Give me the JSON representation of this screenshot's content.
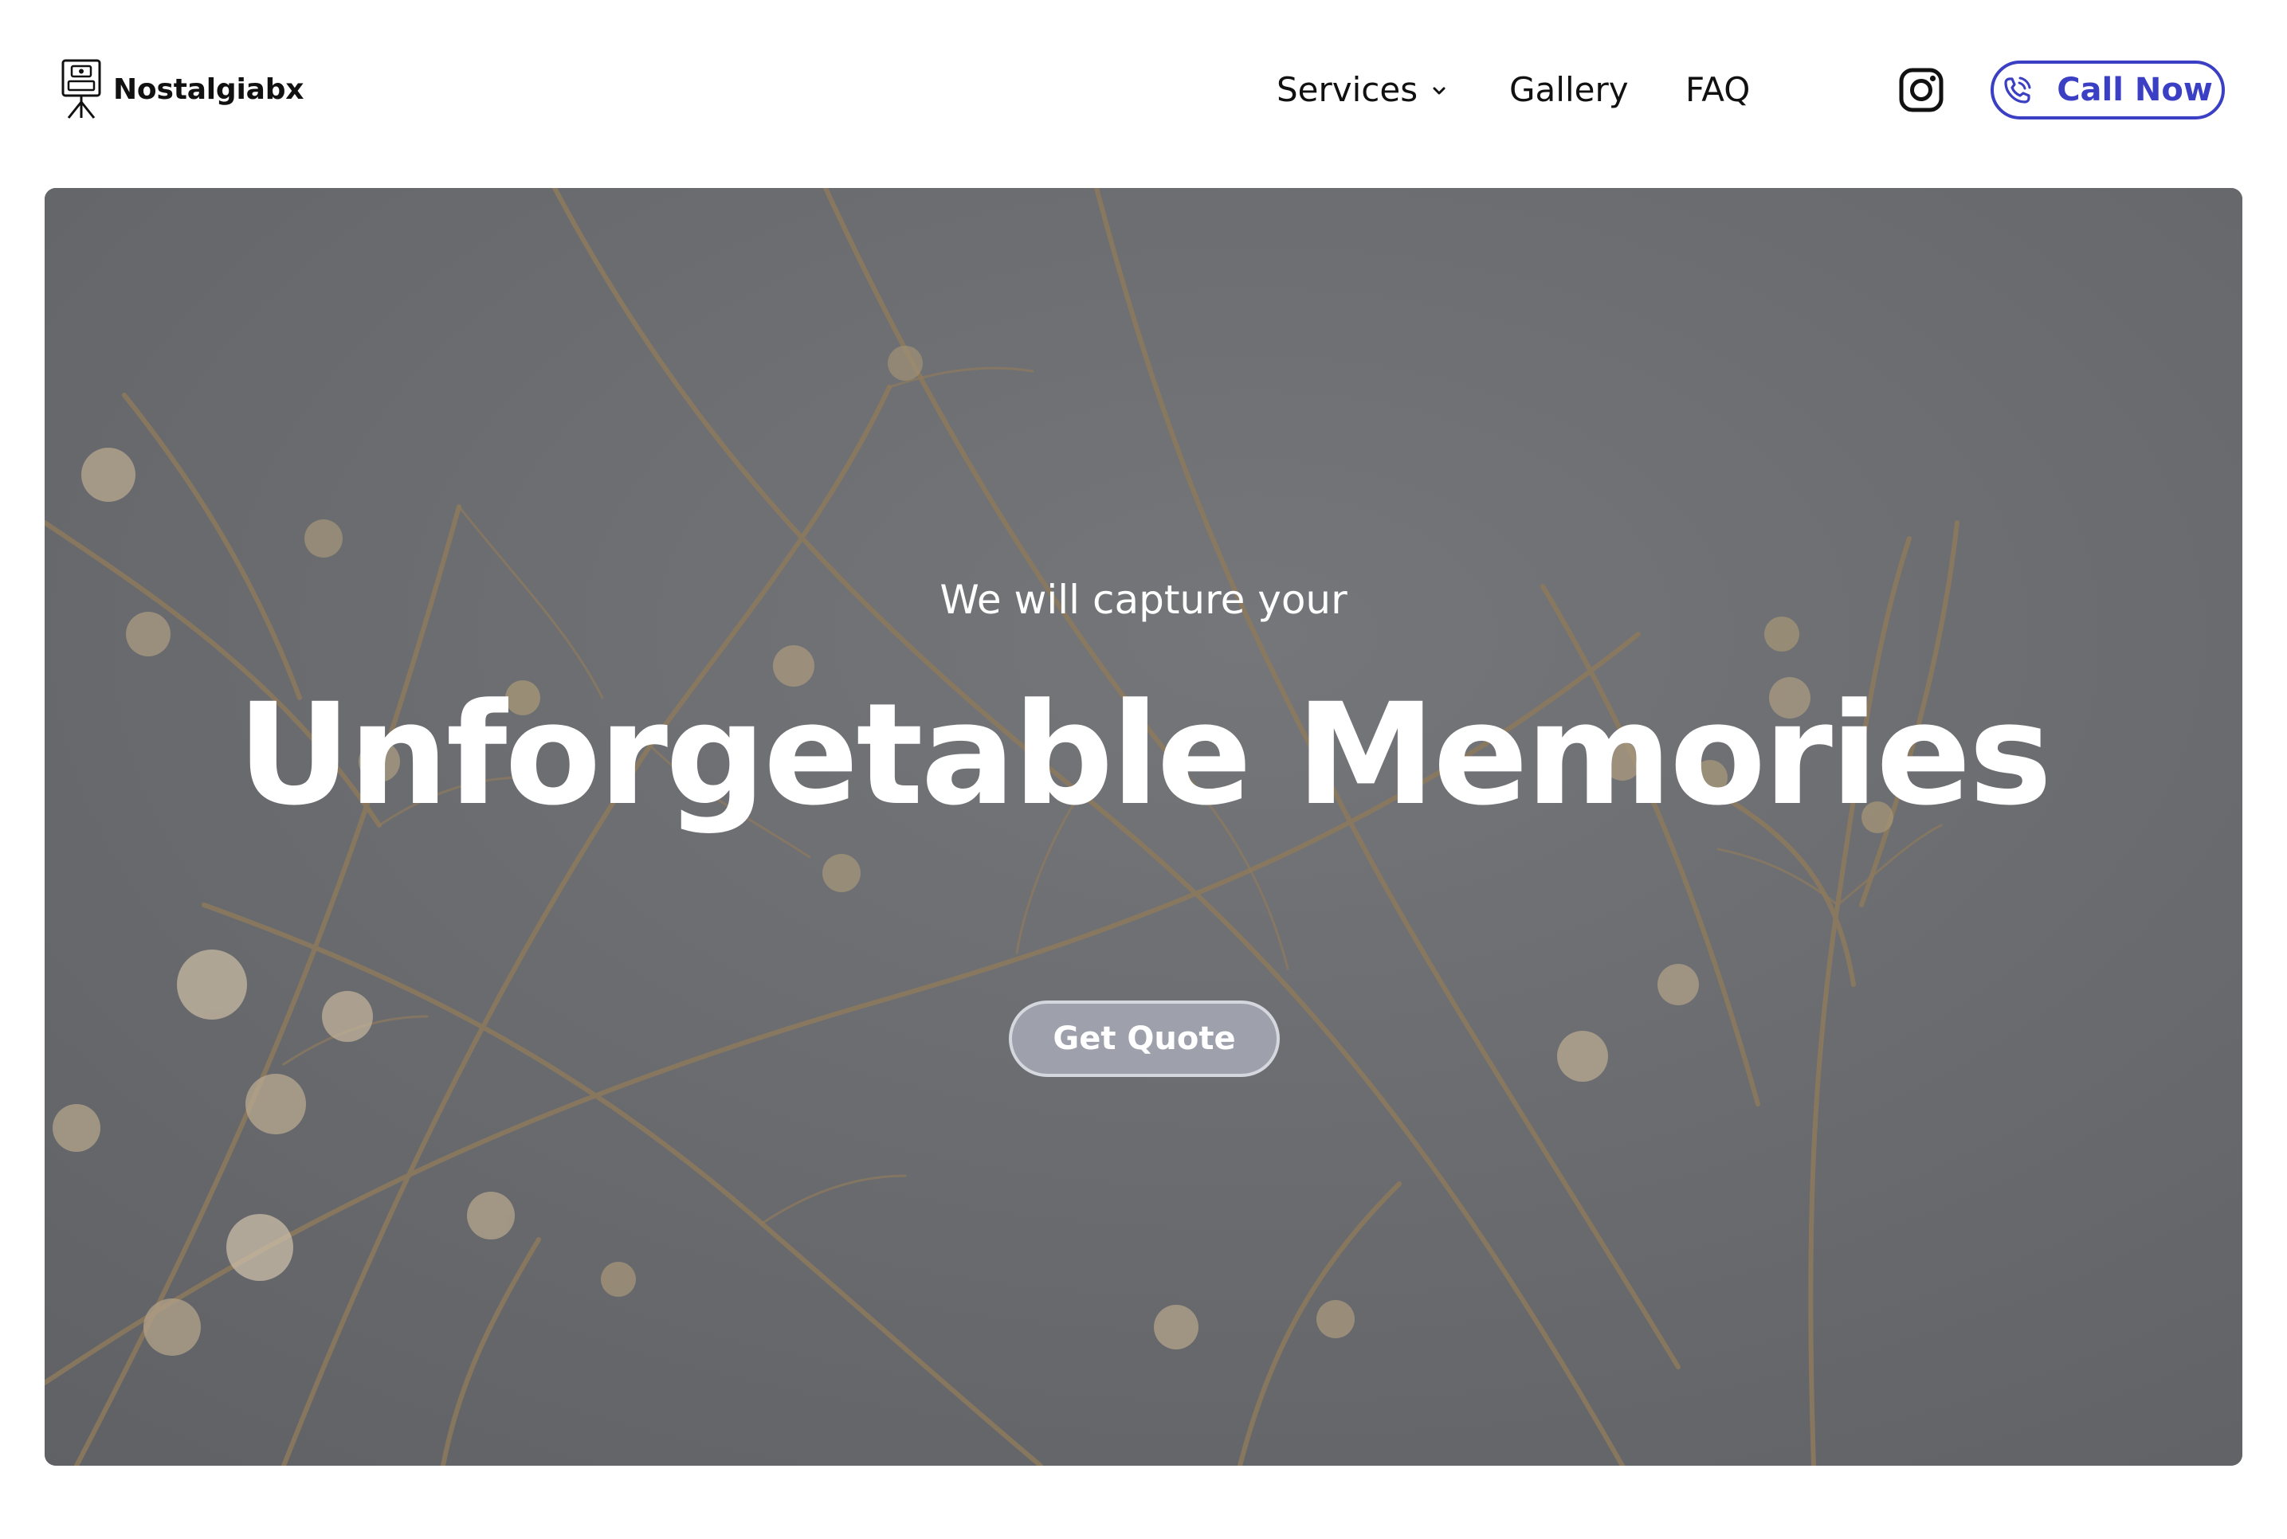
{
  "brand": {
    "name": "Nostalgiabx",
    "logo_icon": "photo-booth-icon"
  },
  "nav": {
    "items": [
      {
        "label": "Services",
        "has_dropdown": true
      },
      {
        "label": "Gallery"
      },
      {
        "label": "FAQ"
      }
    ]
  },
  "social": {
    "instagram_icon": "instagram-icon"
  },
  "cta": {
    "call_label": "Call Now",
    "call_icon": "phone-icon",
    "accent_color": "#3b3fc4"
  },
  "hero": {
    "subtitle": "We will capture your",
    "title": "Unforgetable Memories",
    "button_label": "Get Quote",
    "background": "dried-flowers-photo"
  }
}
